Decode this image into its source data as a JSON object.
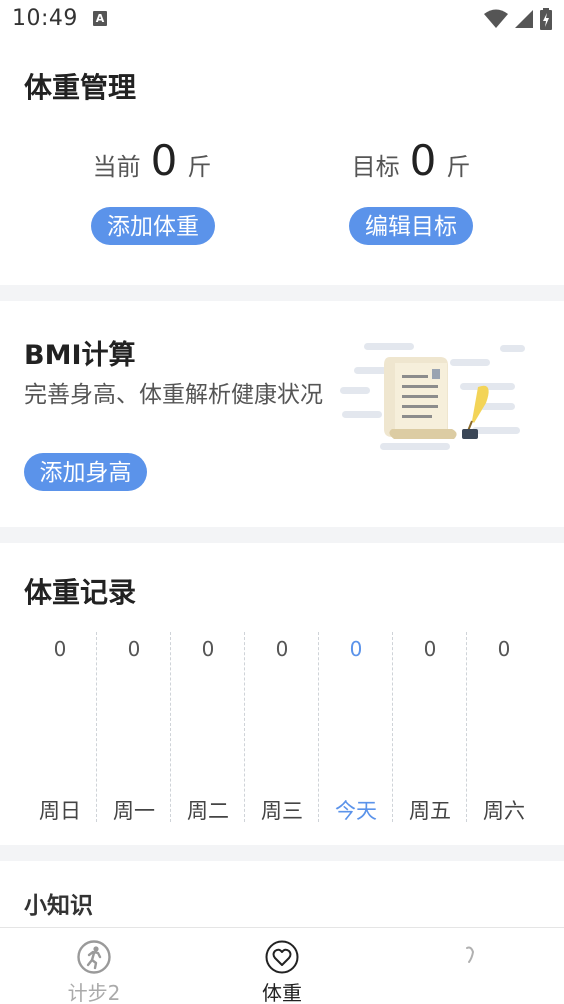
{
  "status_bar": {
    "time": "10:49",
    "notification_letter": "A"
  },
  "weight_card": {
    "title": "体重管理",
    "current": {
      "label": "当前",
      "value": "0",
      "unit": "斤"
    },
    "target": {
      "label": "目标",
      "value": "0",
      "unit": "斤"
    },
    "add_weight_label": "添加体重",
    "edit_target_label": "编辑目标"
  },
  "bmi_card": {
    "title": "BMI计算",
    "subtitle": "完善身高、体重解析健康状况",
    "add_height_label": "添加身高"
  },
  "record_card": {
    "title": "体重记录",
    "days": [
      {
        "label": "周日",
        "value": "0"
      },
      {
        "label": "周一",
        "value": "0"
      },
      {
        "label": "周二",
        "value": "0"
      },
      {
        "label": "周三",
        "value": "0"
      },
      {
        "label": "今天",
        "value": "0"
      },
      {
        "label": "周五",
        "value": "0"
      },
      {
        "label": "周六",
        "value": "0"
      }
    ],
    "today_index": 4
  },
  "tips": {
    "title": "小知识"
  },
  "tabbar": {
    "items": [
      {
        "label": "计步2",
        "icon": "running-person-icon",
        "active": false
      },
      {
        "label": "体重",
        "icon": "heart-outline-icon",
        "active": true
      },
      {
        "label": "",
        "icon": "partial-icon",
        "active": false
      }
    ]
  },
  "colors": {
    "accent": "#5b93ea",
    "background_gap": "#f3f4f6",
    "inactive_tab": "#aaaaaa",
    "active_tab": "#222222"
  }
}
